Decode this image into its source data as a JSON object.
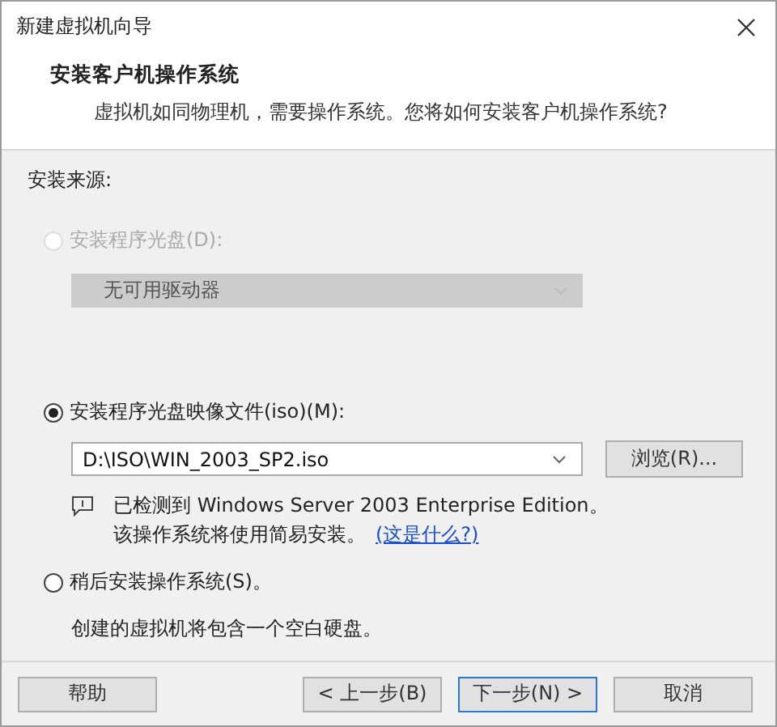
{
  "window": {
    "title": "新建虚拟机向导"
  },
  "header": {
    "title": "安装客户机操作系统",
    "subtitle": "虚拟机如同物理机，需要操作系统。您将如何安装客户机操作系统?"
  },
  "source_label": "安装来源:",
  "options": [
    {
      "kind": "disc",
      "label": "安装程序光盘(D):",
      "selected": false,
      "disabled": true,
      "dropdown": "无可用驱动器"
    },
    {
      "kind": "iso",
      "label": "安装程序光盘映像文件(iso)(M):",
      "selected": true,
      "disabled": false,
      "field": "D:\\ISO\\WIN_2003_SP2.iso",
      "browse": "浏览(R)...",
      "notice": [
        "已检测到 Windows Server 2003 Enterprise Edition。",
        "该操作系统将使用简易安装。"
      ],
      "link": "(这是什么?)"
    },
    {
      "kind": "later",
      "label": "稍后安装操作系统(S)。",
      "selected": false,
      "disabled": false,
      "description": "创建的虚拟机将包含一个空白硬盘。"
    }
  ],
  "help_button": "帮助",
  "buttons": [
    {
      "label": "< 上一步(B)",
      "default": false
    },
    {
      "label": "下一步(N) >",
      "default": true
    },
    {
      "label": "取消",
      "default": false
    }
  ]
}
